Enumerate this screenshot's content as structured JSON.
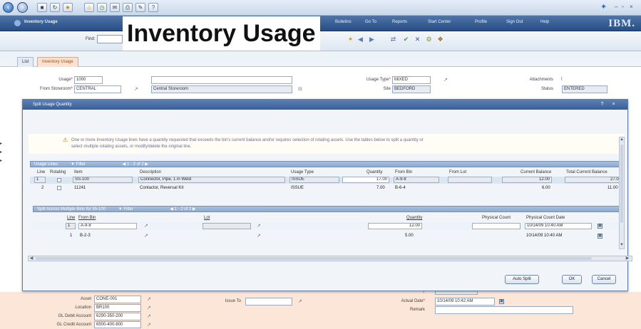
{
  "browser": {
    "back_glyph": "‹",
    "forward_glyph": "›",
    "window_controls": [
      "–",
      "▫",
      "×"
    ]
  },
  "app": {
    "header_title": "Inventory Usage",
    "overlay_title": "Inventory Usage",
    "header_links": [
      "Bulletins",
      "Go To",
      "Reports",
      "Start Center",
      "Profile",
      "Sign Out",
      "Help"
    ],
    "brand": "IBM."
  },
  "toolbar": {
    "find_label": "Find:"
  },
  "tabs": [
    {
      "label": "List"
    },
    {
      "label": "Inventory Usage"
    }
  ],
  "page": {
    "usage_label": "Usage",
    "usage_value": "1000",
    "description_value": "",
    "from_storeroom_label": "From Storeroom",
    "from_storeroom_value": "CENTRAL",
    "storeroom_desc": "Central Storeroom",
    "usage_type_label": "Usage Type",
    "usage_type_value": "MIXED",
    "site_label": "Site",
    "site_value": "BEDFORD",
    "attachments_label": "Attachments",
    "status_label": "Status",
    "status_value": "ENTERED"
  },
  "dialog": {
    "title": "Split Usage Quantity",
    "controls": [
      "?",
      "×"
    ],
    "message_line1": "One or more Inventory Usage lines have a quantity requested that exceeds the bin's current balance and/or requires selection of rotating assets. Use the tables below to split a quantity or",
    "message_line2": "select multiple rotating assets, or modify/delete the original line.",
    "usage_lines": {
      "bar_label": "Usage Lines",
      "bar_filter": "Filter",
      "bar_pager": "1 - 2 of 2",
      "columns": [
        "Line",
        "Rotating",
        "Item",
        "Description",
        "Usage Type",
        "Quantity",
        "From Bin",
        "From Lot",
        "Current Balance",
        "Total Current Balance"
      ],
      "rows": [
        {
          "line": "1",
          "item": "SS-100",
          "description": "Connector, Pipe, 1 in Weld",
          "usage_type": "ISSUE",
          "quantity": "17.00",
          "from_bin": "A-9-8",
          "from_lot": "",
          "current_balance": "12.00",
          "total_current_balance": "27.00"
        },
        {
          "line": "2",
          "item": "11241",
          "description": "Contactor, Reversal Kit",
          "usage_type": "ISSUE",
          "quantity": "7.00",
          "from_bin": "B-6-4",
          "from_lot": "",
          "current_balance": "6.00",
          "total_current_balance": "11.00"
        }
      ]
    },
    "split_section": {
      "bar_label": "Split Across Multiple Bins for 55-100",
      "bar_filter": "Filter",
      "bar_pager": "1 - 2 of 2",
      "columns": [
        "Line",
        "From Bin",
        "Lot",
        "Quantity",
        "Physical Count",
        "Physical Count Date"
      ],
      "rows": [
        {
          "line": "1",
          "from_bin": "A-9-8",
          "lot": "",
          "quantity": "12.00",
          "physical_count": "",
          "physical_count_date": "10/14/09 10:40 AM"
        },
        {
          "line": "1",
          "from_bin": "B-2-3",
          "lot": "",
          "quantity": "5.00",
          "physical_count": "",
          "physical_count_date": "10/14/09 10:40 AM"
        }
      ]
    },
    "buttons": {
      "auto_split": "Auto Split",
      "ok": "OK",
      "cancel": "Cancel"
    }
  },
  "bottom_form": {
    "asset_label": "Asset",
    "asset_value": "CONE-001",
    "location_label": "Location",
    "location_value": "BR100",
    "gl_debit_label": "GL Debit Account",
    "gl_debit_value": "6290-350-200",
    "gl_credit_label": "GL Credit Account",
    "gl_credit_value": "6500-400-800",
    "issue_to_label": "Issue To",
    "issue_to_value": "",
    "entered_by_label": "Entered By",
    "entered_by_value": "WILSON",
    "actual_date_label": "Actual Date",
    "actual_date_value": "10/14/09 10:42 AM",
    "remark_label": "Remark",
    "remark_value": ""
  }
}
